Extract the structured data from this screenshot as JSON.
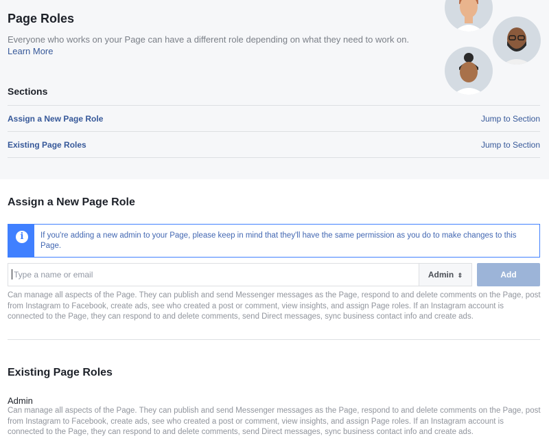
{
  "header": {
    "title": "Page Roles",
    "description": "Everyone who works on your Page can have a different role depending on what they need to work on.",
    "learn_more": "Learn More"
  },
  "sections": {
    "heading": "Sections",
    "items": [
      {
        "label": "Assign a New Page Role",
        "jump": "Jump to Section"
      },
      {
        "label": "Existing Page Roles",
        "jump": "Jump to Section"
      }
    ]
  },
  "assign": {
    "heading": "Assign a New Page Role",
    "notice": "If you're adding a new admin to your Page, please keep in mind that they'll have the same permission as you do to make changes to this Page.",
    "notice_icon": "info-icon",
    "input_placeholder": "Type a name or email",
    "role_selected": "Admin",
    "role_arrow": "⇕",
    "add_label": "Add",
    "role_description": "Can manage all aspects of the Page. They can publish and send Messenger messages as the Page, respond to and delete comments on the Page, post from Instagram to Facebook, create ads, see who created a post or comment, view insights, and assign Page roles. If an Instagram account is connected to the Page, they can respond to and delete comments, send Direct messages, sync business contact info and create ads."
  },
  "existing": {
    "heading": "Existing Page Roles",
    "role_name": "Admin",
    "role_description": "Can manage all aspects of the Page. They can publish and send Messenger messages as the Page, respond to and delete comments on the Page, post from Instagram to Facebook, create ads, see who created a post or comment, view insights, and assign Page roles. If an Instagram account is connected to the Page, they can respond to and delete comments, send Direct messages, sync business contact info and create ads."
  },
  "colors": {
    "link": "#365899",
    "accent": "#4080ff",
    "add_button": "#9cb4d8",
    "top_background": "#f6f7f9"
  }
}
